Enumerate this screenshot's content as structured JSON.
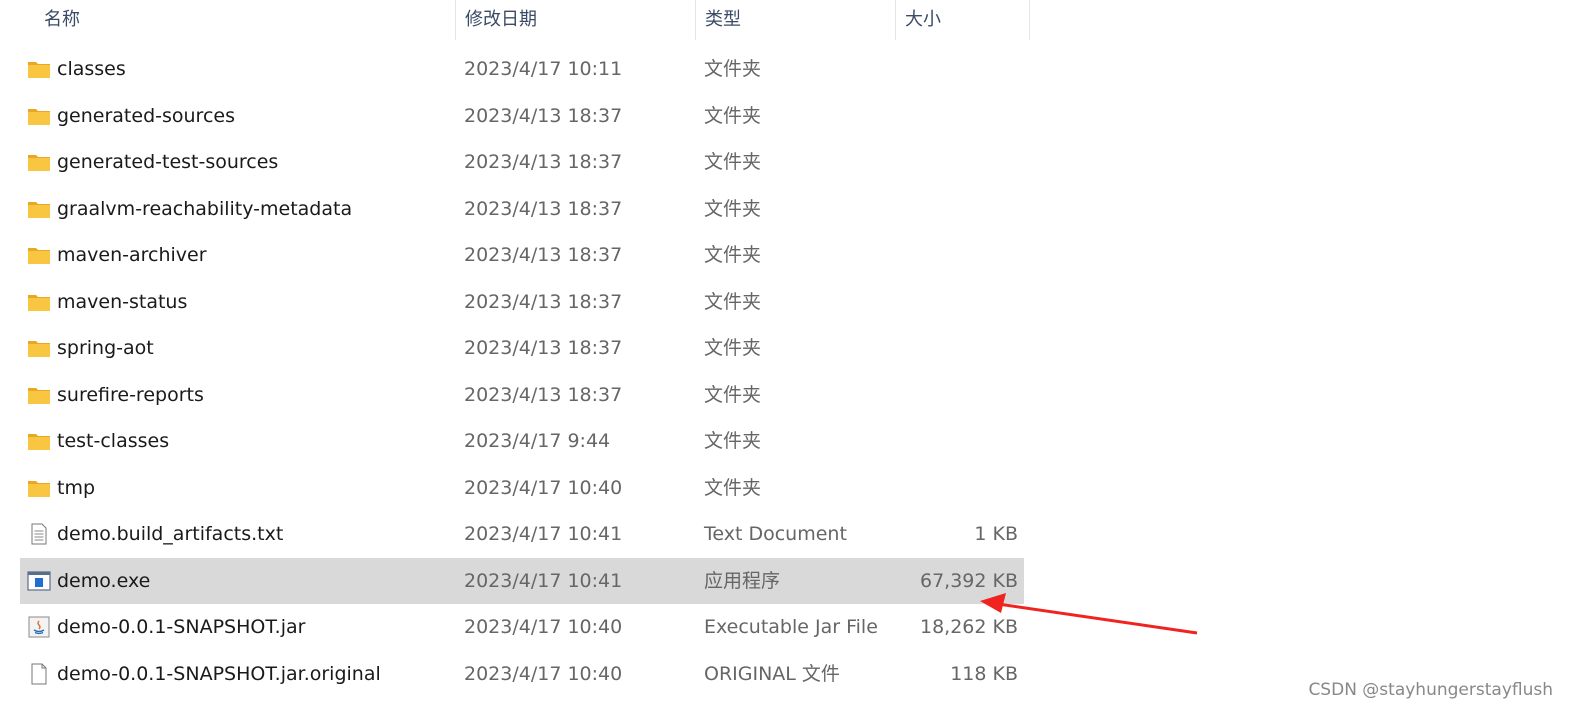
{
  "columns": {
    "name": "名称",
    "date": "修改日期",
    "type": "类型",
    "size": "大小"
  },
  "sort_indicator": "^",
  "files": [
    {
      "icon": "folder-icon",
      "name": "classes",
      "date": "2023/4/17 10:11",
      "type": "文件夹",
      "size": ""
    },
    {
      "icon": "folder-icon",
      "name": "generated-sources",
      "date": "2023/4/13 18:37",
      "type": "文件夹",
      "size": ""
    },
    {
      "icon": "folder-icon",
      "name": "generated-test-sources",
      "date": "2023/4/13 18:37",
      "type": "文件夹",
      "size": ""
    },
    {
      "icon": "folder-icon",
      "name": "graalvm-reachability-metadata",
      "date": "2023/4/13 18:37",
      "type": "文件夹",
      "size": ""
    },
    {
      "icon": "folder-icon",
      "name": "maven-archiver",
      "date": "2023/4/13 18:37",
      "type": "文件夹",
      "size": ""
    },
    {
      "icon": "folder-icon",
      "name": "maven-status",
      "date": "2023/4/13 18:37",
      "type": "文件夹",
      "size": ""
    },
    {
      "icon": "folder-icon",
      "name": "spring-aot",
      "date": "2023/4/13 18:37",
      "type": "文件夹",
      "size": ""
    },
    {
      "icon": "folder-icon",
      "name": "surefire-reports",
      "date": "2023/4/13 18:37",
      "type": "文件夹",
      "size": ""
    },
    {
      "icon": "folder-icon",
      "name": "test-classes",
      "date": "2023/4/17 9:44",
      "type": "文件夹",
      "size": ""
    },
    {
      "icon": "folder-icon",
      "name": "tmp",
      "date": "2023/4/17 10:40",
      "type": "文件夹",
      "size": ""
    },
    {
      "icon": "text-file-icon",
      "name": "demo.build_artifacts.txt",
      "date": "2023/4/17 10:41",
      "type": "Text Document",
      "size": "1 KB"
    },
    {
      "icon": "exe-icon",
      "name": "demo.exe",
      "date": "2023/4/17 10:41",
      "type": "应用程序",
      "size": "67,392 KB",
      "selected": true
    },
    {
      "icon": "java-jar-icon",
      "name": "demo-0.0.1-SNAPSHOT.jar",
      "date": "2023/4/17 10:40",
      "type": "Executable Jar File",
      "size": "18,262 KB"
    },
    {
      "icon": "blank-file-icon",
      "name": "demo-0.0.1-SNAPSHOT.jar.original",
      "date": "2023/4/17 10:40",
      "type": "ORIGINAL 文件",
      "size": "118 KB"
    }
  ],
  "colors": {
    "selected_row": "#d9d9d9",
    "folder": "#f8c640",
    "annotation_arrow": "#f0231e"
  },
  "watermark": "CSDN @stayhungerstayflush"
}
